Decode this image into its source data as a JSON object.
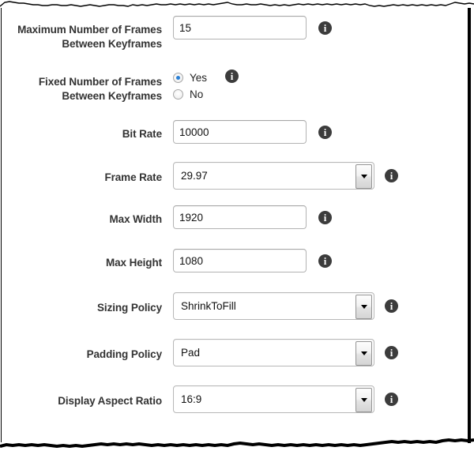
{
  "page": {
    "info_icon_glyph": "i",
    "info_icon_name": "info-icon",
    "accent_color": "#2a7fd4",
    "label_color": "#333333",
    "border_color": "#b3b3b3",
    "frame_color": "#000000"
  },
  "fields": [
    {
      "id": "max-keyframe-interval",
      "label": "Maximum Number of Frames Between Keyframes",
      "type": "text",
      "value": "15",
      "placeholder": "",
      "has_info": true
    },
    {
      "id": "fixed-keyframe-interval",
      "label": "Fixed Number of Frames Between Keyframes",
      "type": "radio",
      "options": [
        {
          "label": "Yes",
          "checked": true
        },
        {
          "label": "No",
          "checked": false
        }
      ],
      "has_info": true
    },
    {
      "id": "bit-rate",
      "label": "Bit Rate",
      "type": "text",
      "value": "10000",
      "placeholder": "",
      "has_info": true
    },
    {
      "id": "frame-rate",
      "label": "Frame Rate",
      "type": "select",
      "value": "29.97",
      "has_info": true
    },
    {
      "id": "max-width",
      "label": "Max Width",
      "type": "text",
      "value": "1920",
      "placeholder": "",
      "has_info": true
    },
    {
      "id": "max-height",
      "label": "Max Height",
      "type": "text",
      "value": "1080",
      "placeholder": "",
      "has_info": true
    },
    {
      "id": "sizing-policy",
      "label": "Sizing Policy",
      "type": "select",
      "value": "ShrinkToFill",
      "has_info": true
    },
    {
      "id": "padding-policy",
      "label": "Padding Policy",
      "type": "select",
      "value": "Pad",
      "has_info": true
    },
    {
      "id": "display-aspect-ratio",
      "label": "Display Aspect Ratio",
      "type": "select",
      "value": "16:9",
      "has_info": true
    }
  ]
}
